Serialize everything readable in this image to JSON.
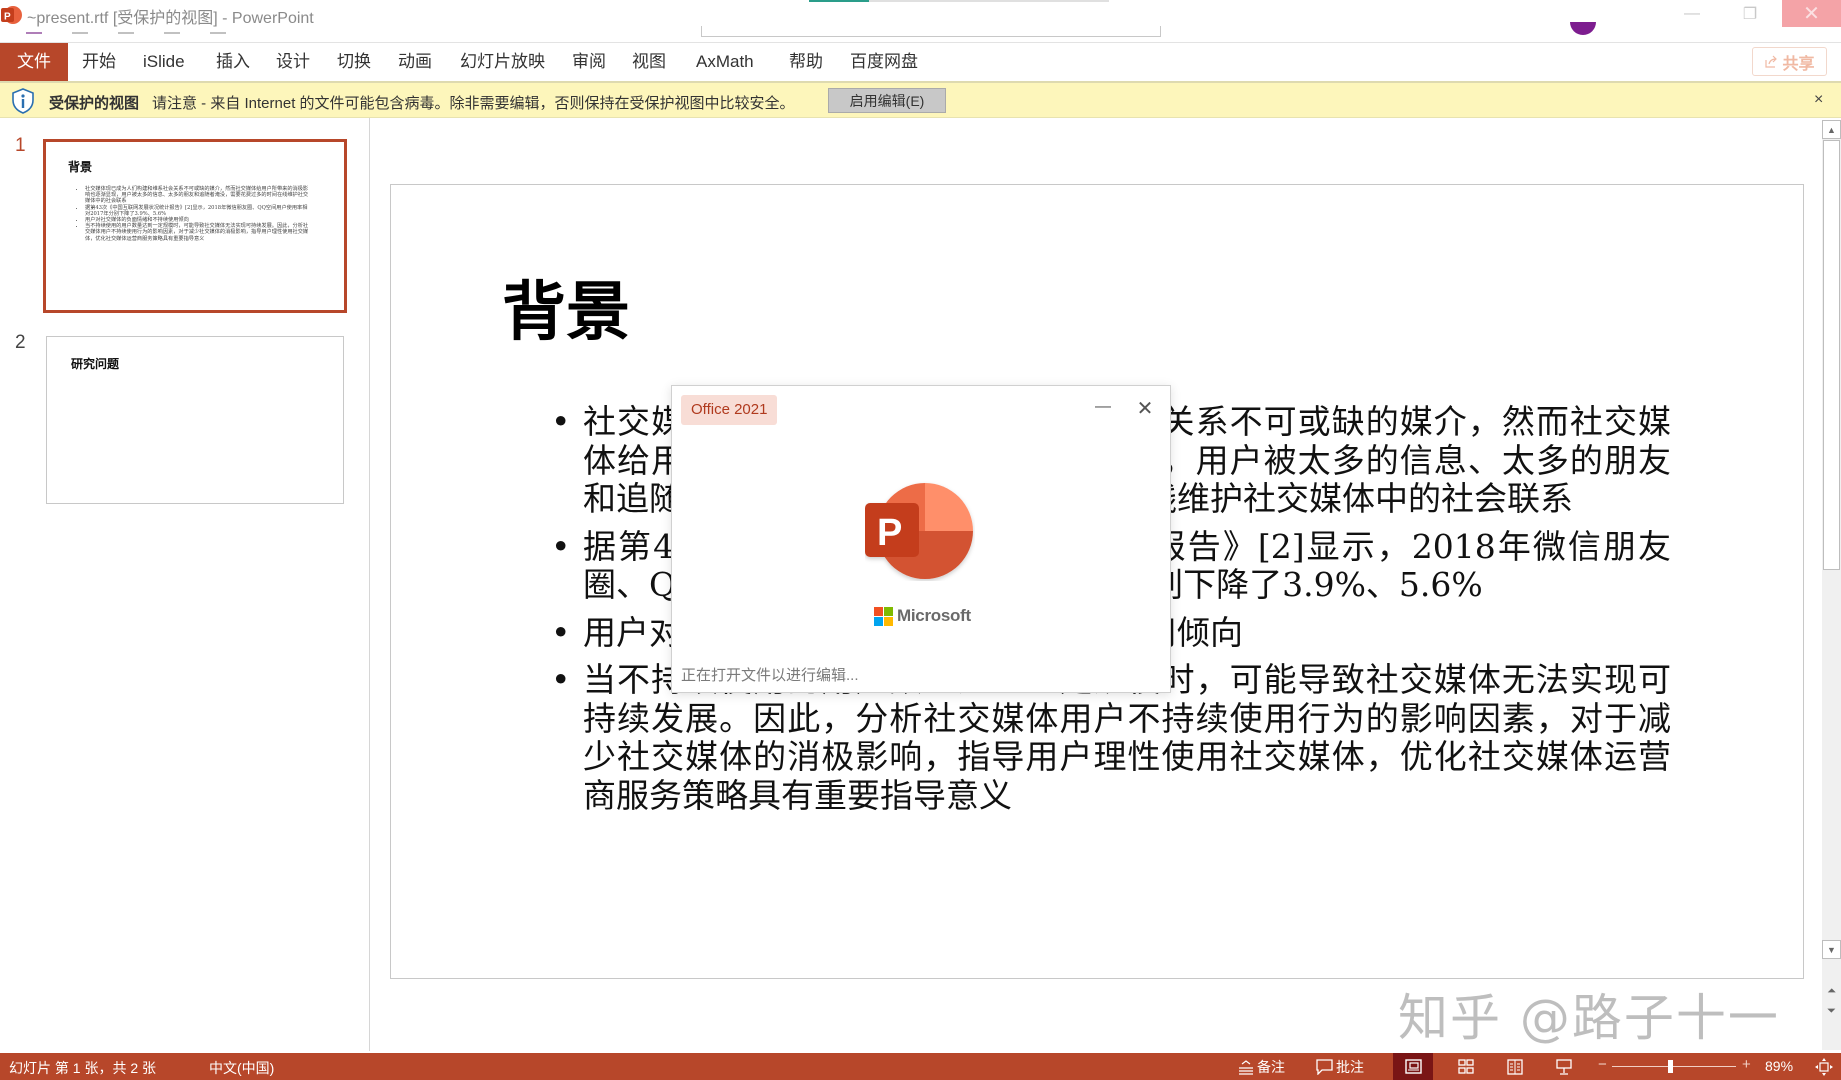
{
  "window": {
    "title": "~present.rtf [受保护的视图] - PowerPoint",
    "controls": {
      "minimize": "—",
      "restore": "❐",
      "close": "✕"
    },
    "open_progress": 0.2
  },
  "ribbon": {
    "tabs": [
      {
        "label": "文件"
      },
      {
        "label": "开始"
      },
      {
        "label": "iSlide"
      },
      {
        "label": "插入"
      },
      {
        "label": "设计"
      },
      {
        "label": "切换"
      },
      {
        "label": "动画"
      },
      {
        "label": "幻灯片放映"
      },
      {
        "label": "审阅"
      },
      {
        "label": "视图"
      },
      {
        "label": "AxMath"
      },
      {
        "label": "帮助"
      },
      {
        "label": "百度网盘"
      }
    ],
    "share_label": "共享"
  },
  "protected_view": {
    "title": "受保护的视图",
    "message": "请注意 - 来自 Internet 的文件可能包含病毒。除非需要编辑，否则保持在受保护视图中比较安全。",
    "enable_button": "启用编辑(E)",
    "close": "×"
  },
  "thumbnails": [
    {
      "number": "1",
      "title": "背景",
      "selected": true,
      "bullets": [
        "社交媒体现已成为人们构建和维系社会关系不可或缺的媒介，然而社交媒体给用户所带来的消极影响也逐渐显现，用户被太多的信息、太多的朋友和追随者淹没，需要花费过多的时间在线维护社交媒体中的社会联系",
        "据第43次《中国互联网发展状况统计报告》[2]显示，2018年微信朋友圈、QQ空间用户使用率相对2017年分别下降了3.9%、5.6%",
        "用户对社交媒体的负面情绪和不持续使用倾向",
        "当不持续使用的用户数量达到一定规模时，可能导致社交媒体无法实现可持续发展。因此，分析社交媒体用户不持续使用行为的影响因素，对于减少社交媒体的消极影响，指导用户理性使用社交媒体，优化社交媒体运营商服务策略具有重要指导意义"
      ]
    },
    {
      "number": "2",
      "title": "研究问题",
      "selected": false
    }
  ],
  "slide": {
    "title": "背景",
    "bullets": [
      "社交媒体现已成为人们构建和维系社会关系不可或缺的媒介，然而社交媒体给用户所带来的消极影响也逐渐显现，用户被太多的信息、太多的朋友和追随者淹没，需要花费过多的时间在线维护社交媒体中的社会联系",
      "据第43次《中国互联网发展状况统计报告》[2]显示，2018年微信朋友圈、QQ空间用户使用率相对2017年分别下降了3.9%、5.6%",
      "用户对社交媒体的负面情绪和不持续使用倾向",
      "当不持续使用的用户数量达到一定规模时，可能导致社交媒体无法实现可持续发展。因此，分析社交媒体用户不持续使用行为的影响因素，对于减少社交媒体的消极影响，指导用户理性使用社交媒体，优化社交媒体运营商服务策略具有重要指导意义"
    ]
  },
  "splash": {
    "badge": "Office 2021",
    "brand": "Microsoft",
    "status": "正在打开文件以进行编辑...",
    "minimize": "—",
    "close": "✕"
  },
  "watermark": "知乎 @路子十一",
  "statusbar": {
    "slide_info": "幻灯片 第 1 张，共 2 张",
    "language": "中文(中国)",
    "notes_label": "备注",
    "comments_label": "批注",
    "zoom_minus": "−",
    "zoom_plus": "+",
    "zoom_level": "89%",
    "zoom_fraction": 0.45
  },
  "colors": {
    "accent": "#b7472a",
    "active_view": "#7a1515",
    "protected_bar": "#fdf6bb",
    "badge_bg": "#f8ddd6"
  }
}
